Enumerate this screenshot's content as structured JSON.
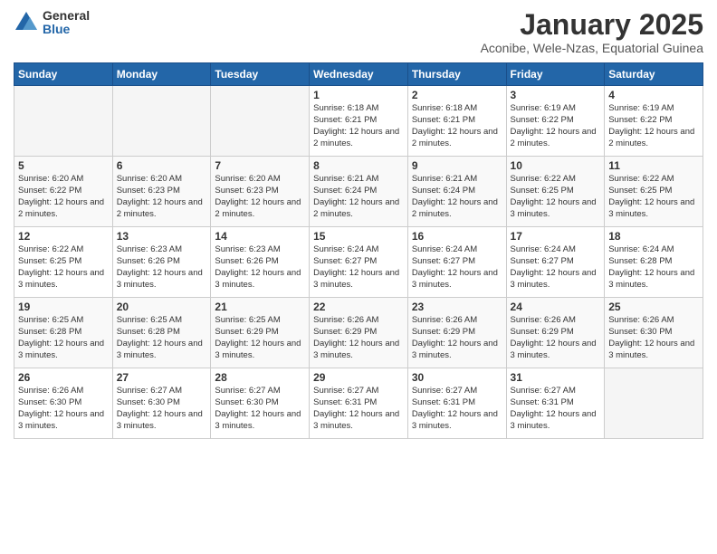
{
  "logo": {
    "general": "General",
    "blue": "Blue"
  },
  "title": "January 2025",
  "subtitle": "Aconibe, Wele-Nzas, Equatorial Guinea",
  "days_of_week": [
    "Sunday",
    "Monday",
    "Tuesday",
    "Wednesday",
    "Thursday",
    "Friday",
    "Saturday"
  ],
  "weeks": [
    [
      {
        "day": "",
        "info": ""
      },
      {
        "day": "",
        "info": ""
      },
      {
        "day": "",
        "info": ""
      },
      {
        "day": "1",
        "info": "Sunrise: 6:18 AM\nSunset: 6:21 PM\nDaylight: 12 hours and 2 minutes."
      },
      {
        "day": "2",
        "info": "Sunrise: 6:18 AM\nSunset: 6:21 PM\nDaylight: 12 hours and 2 minutes."
      },
      {
        "day": "3",
        "info": "Sunrise: 6:19 AM\nSunset: 6:22 PM\nDaylight: 12 hours and 2 minutes."
      },
      {
        "day": "4",
        "info": "Sunrise: 6:19 AM\nSunset: 6:22 PM\nDaylight: 12 hours and 2 minutes."
      }
    ],
    [
      {
        "day": "5",
        "info": "Sunrise: 6:20 AM\nSunset: 6:22 PM\nDaylight: 12 hours and 2 minutes."
      },
      {
        "day": "6",
        "info": "Sunrise: 6:20 AM\nSunset: 6:23 PM\nDaylight: 12 hours and 2 minutes."
      },
      {
        "day": "7",
        "info": "Sunrise: 6:20 AM\nSunset: 6:23 PM\nDaylight: 12 hours and 2 minutes."
      },
      {
        "day": "8",
        "info": "Sunrise: 6:21 AM\nSunset: 6:24 PM\nDaylight: 12 hours and 2 minutes."
      },
      {
        "day": "9",
        "info": "Sunrise: 6:21 AM\nSunset: 6:24 PM\nDaylight: 12 hours and 2 minutes."
      },
      {
        "day": "10",
        "info": "Sunrise: 6:22 AM\nSunset: 6:25 PM\nDaylight: 12 hours and 3 minutes."
      },
      {
        "day": "11",
        "info": "Sunrise: 6:22 AM\nSunset: 6:25 PM\nDaylight: 12 hours and 3 minutes."
      }
    ],
    [
      {
        "day": "12",
        "info": "Sunrise: 6:22 AM\nSunset: 6:25 PM\nDaylight: 12 hours and 3 minutes."
      },
      {
        "day": "13",
        "info": "Sunrise: 6:23 AM\nSunset: 6:26 PM\nDaylight: 12 hours and 3 minutes."
      },
      {
        "day": "14",
        "info": "Sunrise: 6:23 AM\nSunset: 6:26 PM\nDaylight: 12 hours and 3 minutes."
      },
      {
        "day": "15",
        "info": "Sunrise: 6:24 AM\nSunset: 6:27 PM\nDaylight: 12 hours and 3 minutes."
      },
      {
        "day": "16",
        "info": "Sunrise: 6:24 AM\nSunset: 6:27 PM\nDaylight: 12 hours and 3 minutes."
      },
      {
        "day": "17",
        "info": "Sunrise: 6:24 AM\nSunset: 6:27 PM\nDaylight: 12 hours and 3 minutes."
      },
      {
        "day": "18",
        "info": "Sunrise: 6:24 AM\nSunset: 6:28 PM\nDaylight: 12 hours and 3 minutes."
      }
    ],
    [
      {
        "day": "19",
        "info": "Sunrise: 6:25 AM\nSunset: 6:28 PM\nDaylight: 12 hours and 3 minutes."
      },
      {
        "day": "20",
        "info": "Sunrise: 6:25 AM\nSunset: 6:28 PM\nDaylight: 12 hours and 3 minutes."
      },
      {
        "day": "21",
        "info": "Sunrise: 6:25 AM\nSunset: 6:29 PM\nDaylight: 12 hours and 3 minutes."
      },
      {
        "day": "22",
        "info": "Sunrise: 6:26 AM\nSunset: 6:29 PM\nDaylight: 12 hours and 3 minutes."
      },
      {
        "day": "23",
        "info": "Sunrise: 6:26 AM\nSunset: 6:29 PM\nDaylight: 12 hours and 3 minutes."
      },
      {
        "day": "24",
        "info": "Sunrise: 6:26 AM\nSunset: 6:29 PM\nDaylight: 12 hours and 3 minutes."
      },
      {
        "day": "25",
        "info": "Sunrise: 6:26 AM\nSunset: 6:30 PM\nDaylight: 12 hours and 3 minutes."
      }
    ],
    [
      {
        "day": "26",
        "info": "Sunrise: 6:26 AM\nSunset: 6:30 PM\nDaylight: 12 hours and 3 minutes."
      },
      {
        "day": "27",
        "info": "Sunrise: 6:27 AM\nSunset: 6:30 PM\nDaylight: 12 hours and 3 minutes."
      },
      {
        "day": "28",
        "info": "Sunrise: 6:27 AM\nSunset: 6:30 PM\nDaylight: 12 hours and 3 minutes."
      },
      {
        "day": "29",
        "info": "Sunrise: 6:27 AM\nSunset: 6:31 PM\nDaylight: 12 hours and 3 minutes."
      },
      {
        "day": "30",
        "info": "Sunrise: 6:27 AM\nSunset: 6:31 PM\nDaylight: 12 hours and 3 minutes."
      },
      {
        "day": "31",
        "info": "Sunrise: 6:27 AM\nSunset: 6:31 PM\nDaylight: 12 hours and 3 minutes."
      },
      {
        "day": "",
        "info": ""
      }
    ]
  ]
}
